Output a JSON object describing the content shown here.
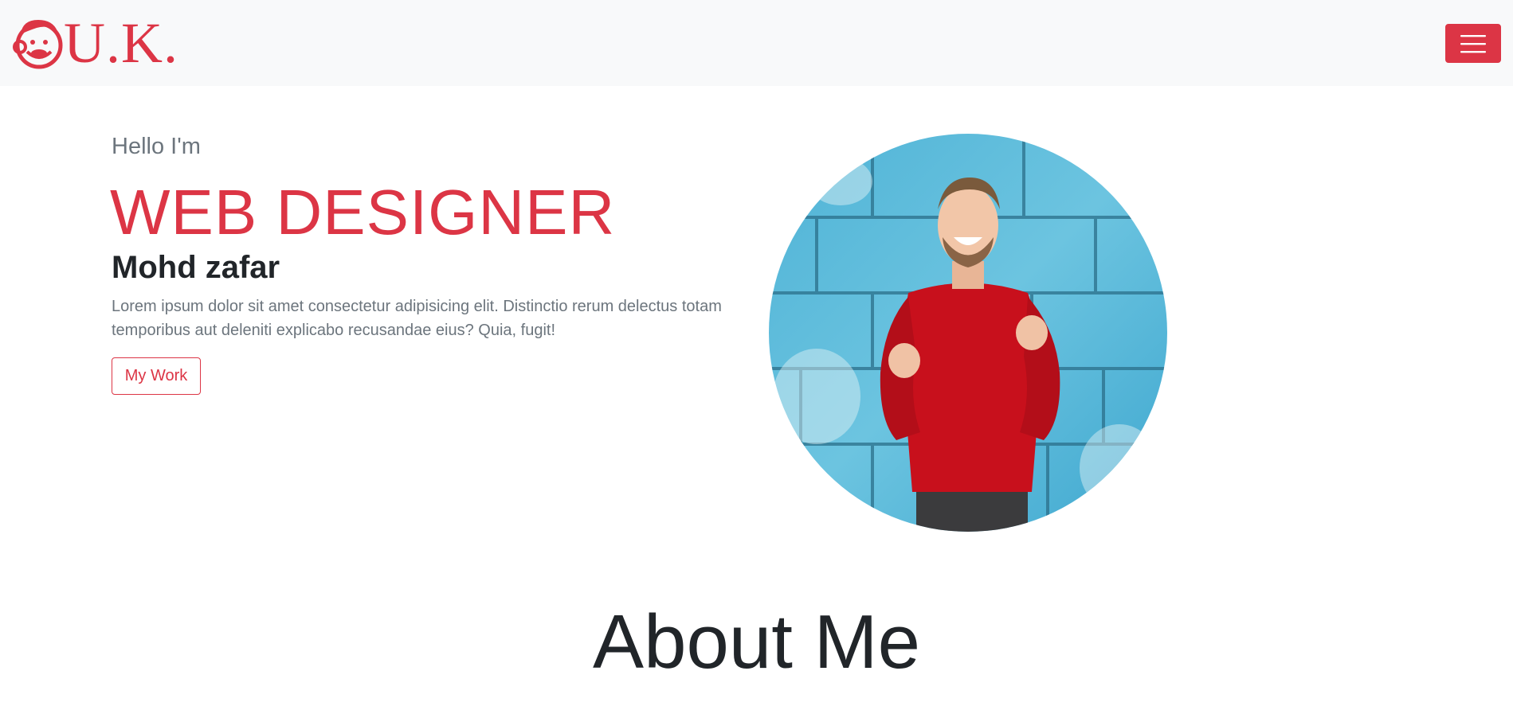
{
  "navbar": {
    "brand_text": "U.K.",
    "brand_logo_icon": "monkey-logo-icon",
    "toggler_icon": "hamburger-menu-icon"
  },
  "hero": {
    "greeting": "Hello I'm",
    "role": "WEB DESIGNER",
    "name": "Mohd zafar",
    "description": "Lorem ipsum dolor sit amet consectetur adipisicing elit. Distinctio rerum delectus totam temporibus aut deleniti explicabo recusandae eius? Quia, fugit!",
    "button_label": "My Work",
    "portrait_image": "man-red-sweater-blue-brick-wall-photo"
  },
  "about": {
    "heading": "About Me"
  },
  "colors": {
    "accent": "#dc3545",
    "muted": "#6c757d",
    "dark": "#212529",
    "navbar_bg": "#f8f9fa"
  }
}
